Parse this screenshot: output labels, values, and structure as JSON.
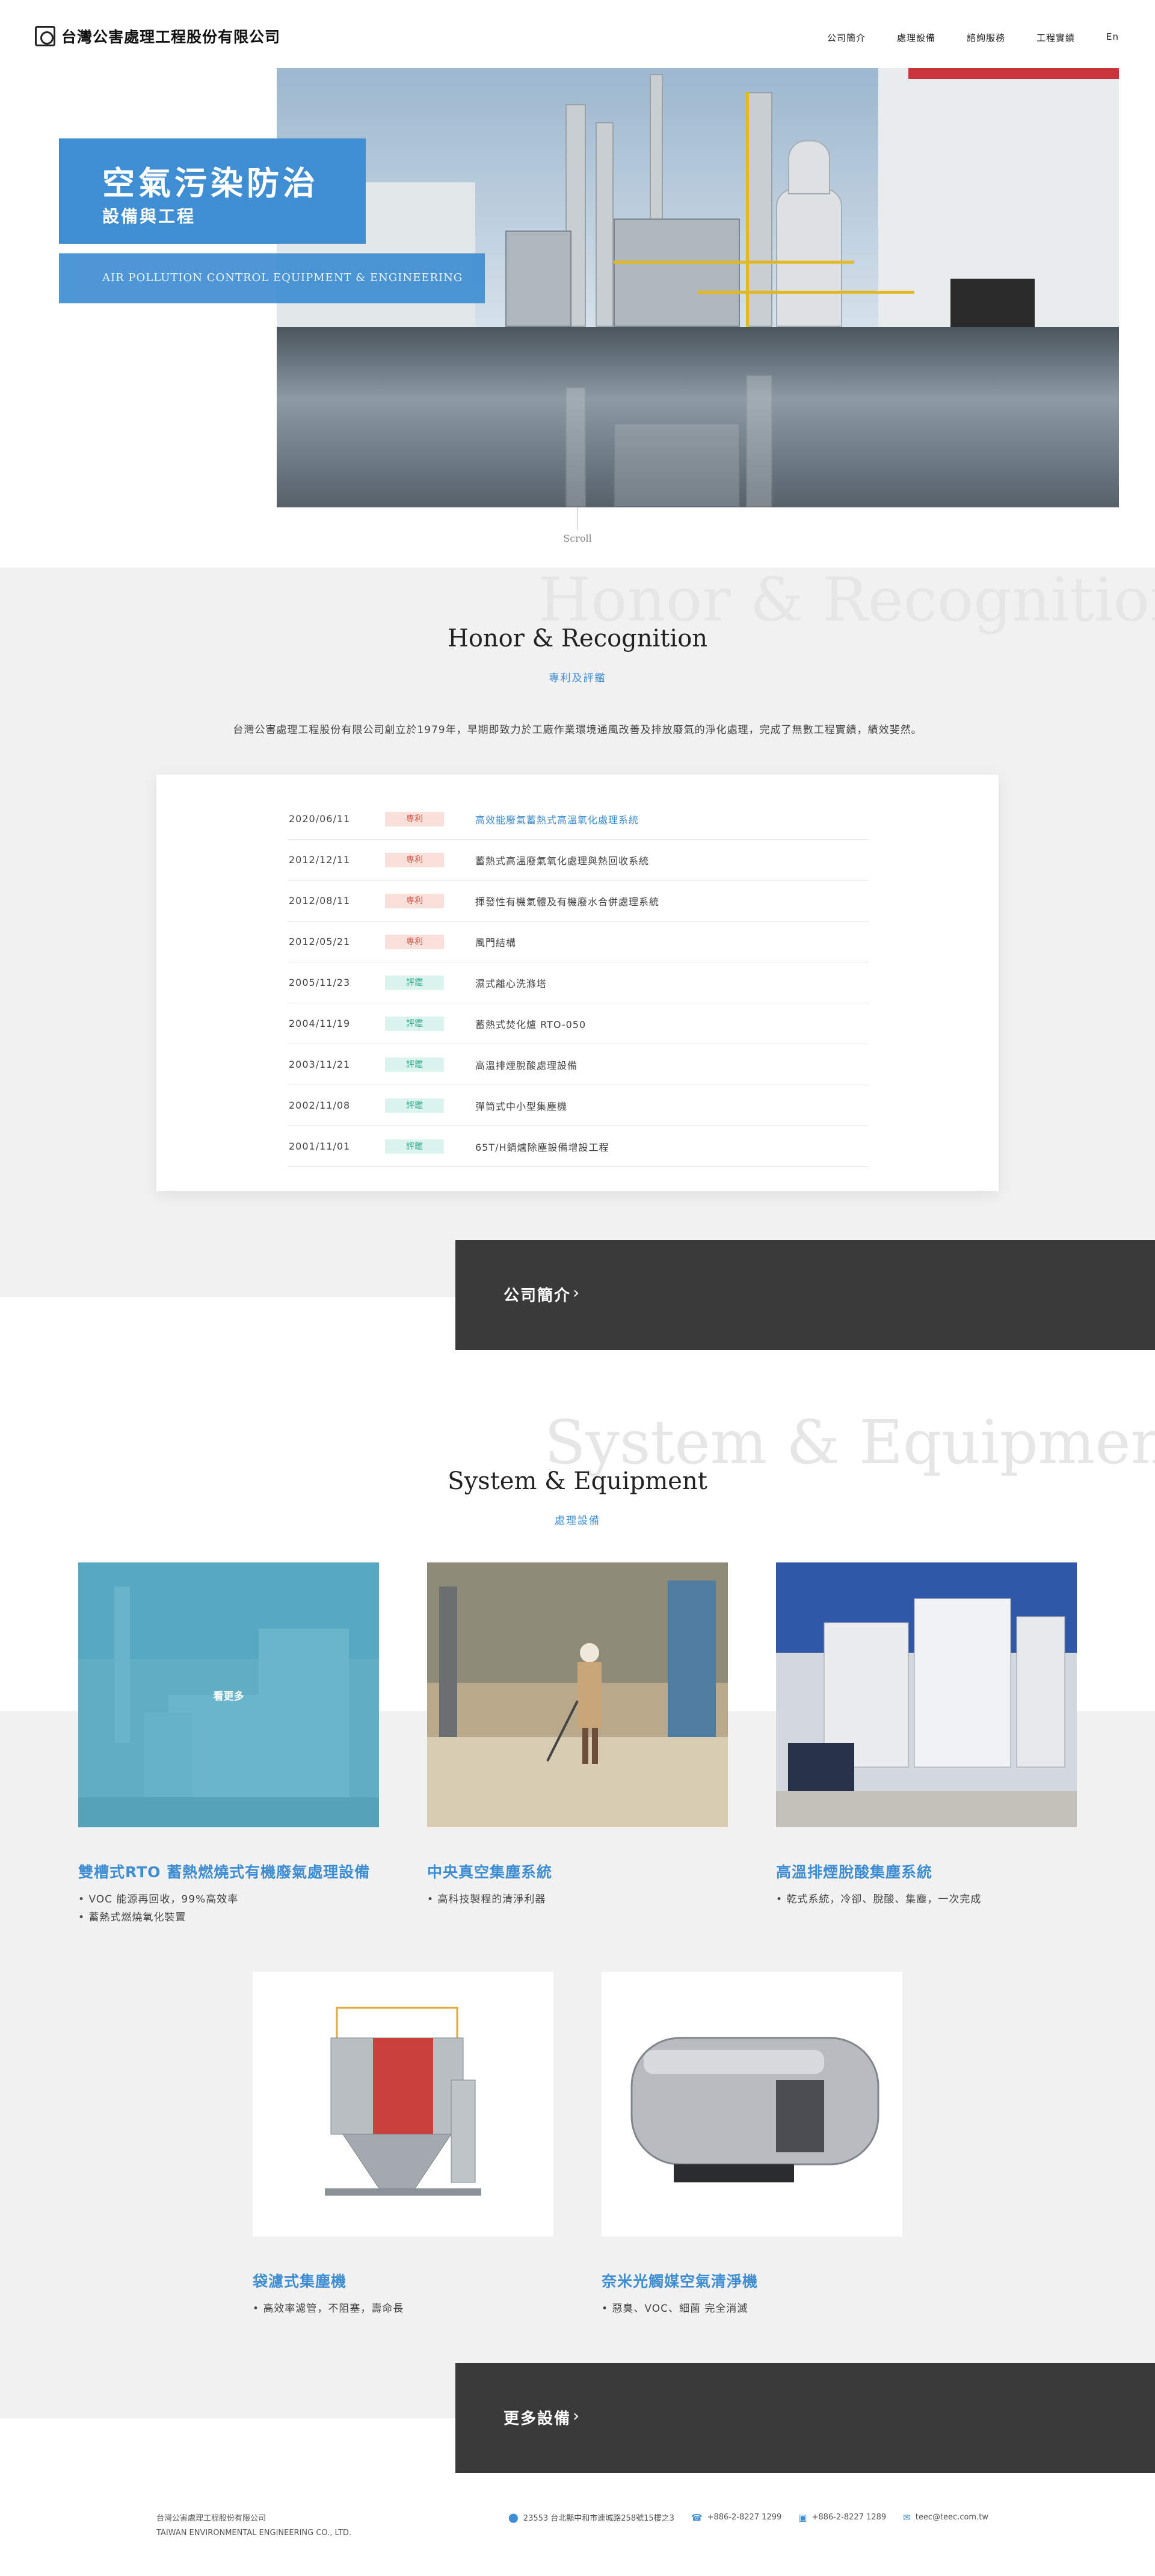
{
  "header": {
    "logo_text": "台灣公害處理工程股份有限公司",
    "nav": [
      "公司簡介",
      "處理設備",
      "諮詢服務",
      "工程實績",
      "En"
    ]
  },
  "hero": {
    "title": "空氣污染防治",
    "subtitle": "設備與工程",
    "english": "AIR POLLUTION CONTROL EQUIPMENT & ENGINEERING",
    "scroll_label": "Scroll"
  },
  "honor": {
    "watermark": "Honor & Recognition",
    "title": "Honor & Recognition",
    "subtitle": "專利及評鑑",
    "description": "台灣公害處理工程股份有限公司創立於1979年，早期即致力於工廠作業環境通風改善及排放廢氣的淨化處理，完成了無數工程實績，績效斐然。",
    "rows": [
      {
        "date": "2020/06/11",
        "badge": "專利",
        "name": "高效能廢氣蓄熱式高溫氧化處理系統"
      },
      {
        "date": "2012/12/11",
        "badge": "專利",
        "name": "蓄熱式高溫廢氣氧化處理與熱回收系統"
      },
      {
        "date": "2012/08/11",
        "badge": "專利",
        "name": "揮發性有機氣體及有機廢水合併處理系統"
      },
      {
        "date": "2012/05/21",
        "badge": "專利",
        "name": "風門結構"
      },
      {
        "date": "2005/11/23",
        "badge": "評鑑",
        "name": "濕式離心洗滌塔"
      },
      {
        "date": "2004/11/19",
        "badge": "評鑑",
        "name": "蓄熱式焚化爐 RTO-050"
      },
      {
        "date": "2003/11/21",
        "badge": "評鑑",
        "name": "高溫排煙脫酸處理設備"
      },
      {
        "date": "2002/11/08",
        "badge": "評鑑",
        "name": "彈筒式中小型集塵機"
      },
      {
        "date": "2001/11/01",
        "badge": "評鑑",
        "name": "65T/H鍋爐除塵設備增設工程"
      }
    ],
    "cta_label": "公司簡介"
  },
  "equipment": {
    "watermark": "System & Equipment",
    "title": "System & Equipment",
    "subtitle": "處理設備",
    "more_label": "看更多",
    "items": [
      {
        "title": "雙槽式RTO 蓄熱燃燒式有機廢氣處理設備",
        "bullets": [
          "VOC 能源再回收，99%高效率",
          "蓄熱式燃燒氧化裝置"
        ]
      },
      {
        "title": "中央真空集塵系統",
        "bullets": [
          "高科技製程的清淨利器"
        ]
      },
      {
        "title": "高溫排煙脫酸集塵系統",
        "bullets": [
          "乾式系統，冷卻、脫酸、集塵，一次完成"
        ]
      },
      {
        "title": "袋濾式集塵機",
        "bullets": [
          "高效率濾管，不阻塞，壽命長"
        ]
      },
      {
        "title": "奈米光觸媒空氣清淨機",
        "bullets": [
          "惡臭、VOC、細菌 完全消滅"
        ]
      }
    ],
    "cta_label": "更多設備"
  },
  "footer": {
    "company_zh": "台灣公害處理工程股份有限公司",
    "company_en": "TAIWAN ENVIRONMENTAL ENGINEERING CO., LTD.",
    "address": "23553 台北縣中和市連城路258號15樓之3",
    "phone": "+886-2-8227 1299",
    "fax": "+886-2-8227 1289",
    "email": "teec@teec.com.tw"
  },
  "colors": {
    "accent": "#3f8ed3",
    "dark": "#3a3a3a",
    "light_bg": "#f1f1f1",
    "patent": "#d0574a",
    "review": "#3fae95"
  }
}
